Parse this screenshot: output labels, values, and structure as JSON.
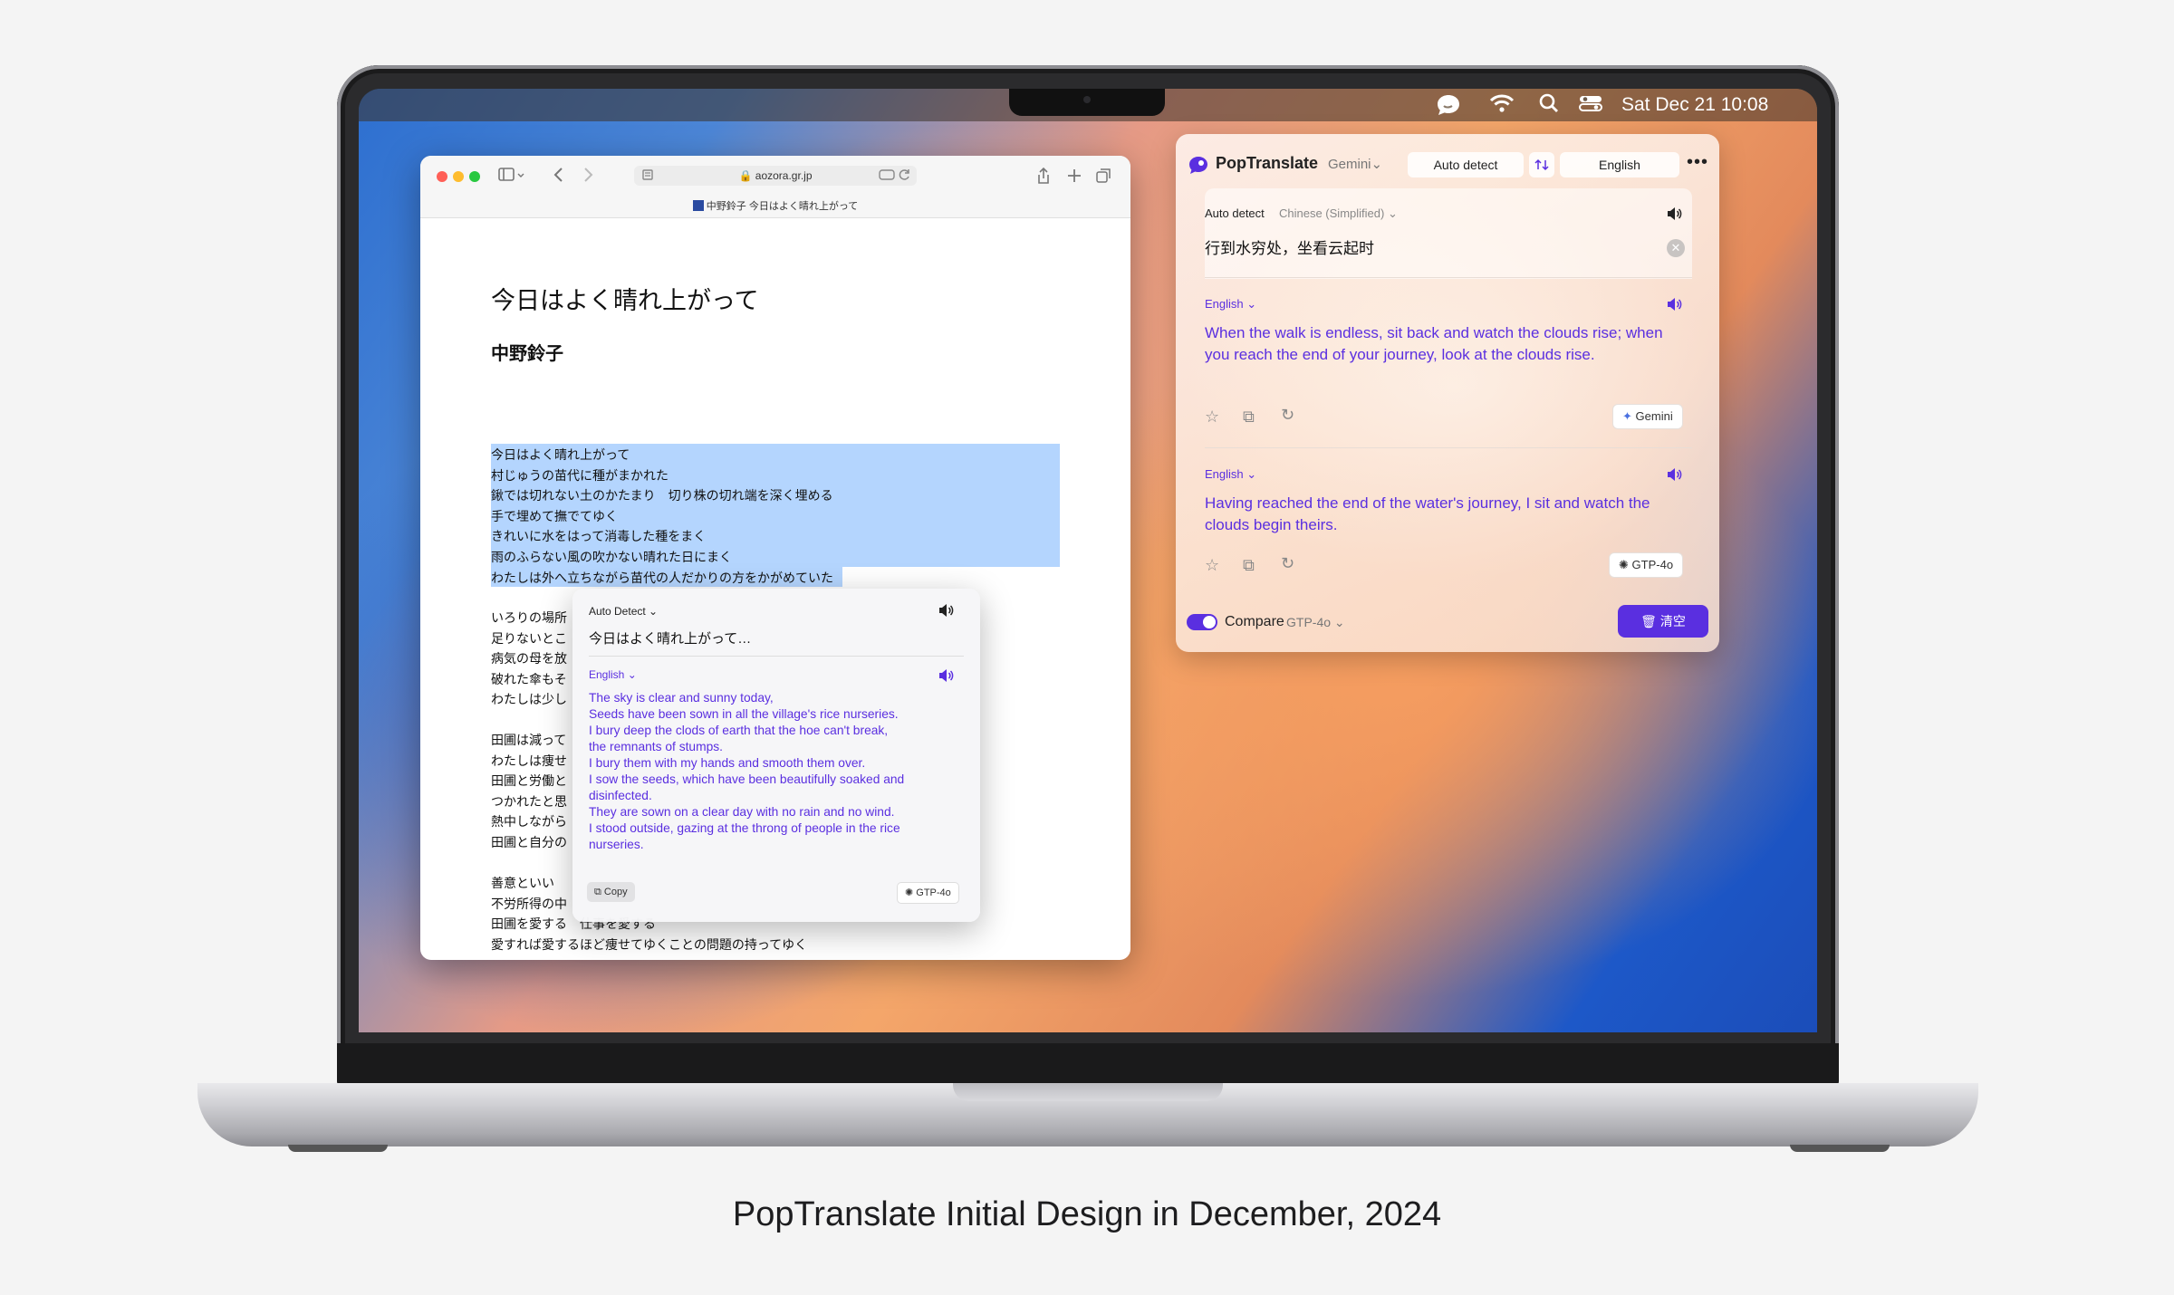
{
  "menubar": {
    "clock": "Sat Dec 21 10:08",
    "icons": [
      "poptranslate-icon",
      "wifi-icon",
      "search-icon",
      "control-center-icon"
    ]
  },
  "browser": {
    "url": "aozora.gr.jp",
    "tab_title": "中野鈴子 今日はよく晴れ上がって",
    "title": "今日はよく晴れ上がって",
    "author": "中野鈴子",
    "poem_selected": [
      "今日はよく晴れ上がって",
      "村じゅうの苗代に種がまかれた",
      "鍬では切れない土のかたまり　切り株の切れ端を深く埋める",
      "手で埋めて撫でてゆく",
      "きれいに水をはって消毒した種をまく",
      "雨のふらない風の吹かない晴れた日にまく",
      "わたしは外へ立ちながら苗代の人だかりの方をかがめていた"
    ],
    "poem_stanza2": [
      "いろりの場所",
      "足りないとこ",
      "病気の母を放",
      "破れた傘もそ",
      "わたしは少し"
    ],
    "poem_stanza3": [
      "田圃は減って",
      "わたしは痩せ",
      "田圃と労働と",
      "つかれたと思",
      "熱中しながら",
      "田圃と自分の"
    ],
    "poem_stanza4": [
      "善意といい",
      "不労所得の中",
      "田圃を愛する　仕事を愛する",
      "愛すれば愛するほど痩せてゆくことの問題の持ってゆく"
    ]
  },
  "popup": {
    "source_lang": "Auto Detect",
    "source_text": "今日はよく晴れ上がって…",
    "target_lang": "English",
    "translation": [
      "The sky is clear and sunny today,",
      "Seeds have been sown in all the village's rice nurseries.",
      "I bury deep the clods of earth that the hoe can't break,",
      "the remnants of stumps.",
      "I bury them with my hands and smooth them over.",
      "I sow the seeds, which have been beautifully soaked and",
      "disinfected.",
      "They are sown on a clear day with no rain and no wind.",
      "I stood outside, gazing at the throng of people in the rice",
      "nurseries."
    ],
    "copy_label": "Copy",
    "engine": "GTP-4o"
  },
  "panel": {
    "app_name": "PopTranslate",
    "engine_select": "Gemini",
    "source_button": "Auto detect",
    "target_button": "English",
    "source_label": "Auto detect",
    "detected_lang": "Chinese (Simplified)",
    "source_text": "行到水穷处，坐看云起时",
    "result1_lang": "English",
    "result1_text": "When the walk is endless, sit back and watch the clouds rise; when you reach the end of your journey, look at the clouds rise.",
    "result1_engine": "Gemini",
    "result2_lang": "English",
    "result2_text": "Having reached the end of the water's journey, I sit and watch the clouds begin theirs.",
    "result2_engine": "GTP-4o",
    "compare_label": "Compare",
    "compare_engine": "GTP-4o",
    "clear_button": "清空"
  },
  "caption": "PopTranslate Initial Design in December, 2024",
  "colors": {
    "accent": "#5a2fe0",
    "selection": "#b4d5fe",
    "panel_bg": "#fbeee6"
  }
}
